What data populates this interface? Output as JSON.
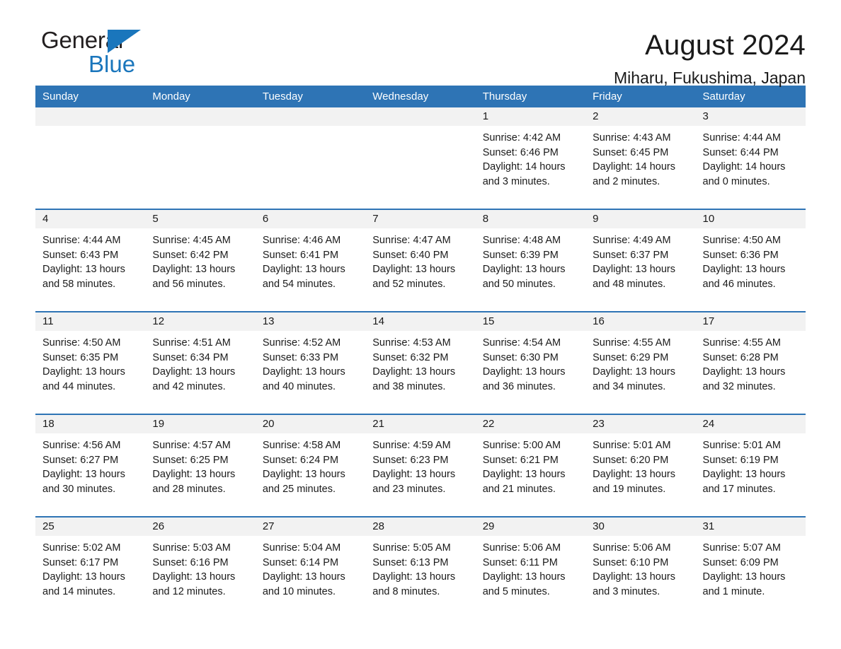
{
  "logo": {
    "word_one": "General",
    "word_two": "Blue",
    "triangle": "blue-triangle"
  },
  "header": {
    "title": "August 2024",
    "subtitle": "Miharu, Fukushima, Japan"
  },
  "colors": {
    "header_blue": "#2e74b5",
    "logo_blue": "#1a76bc",
    "daynum_band": "#f2f2f2",
    "text": "#1a1a1a",
    "page_background": "#ffffff"
  },
  "weekday_headers": [
    "Sunday",
    "Monday",
    "Tuesday",
    "Wednesday",
    "Thursday",
    "Friday",
    "Saturday"
  ],
  "weeks": [
    [
      {
        "day": "",
        "sunrise": "",
        "sunset": "",
        "daylight": ""
      },
      {
        "day": "",
        "sunrise": "",
        "sunset": "",
        "daylight": ""
      },
      {
        "day": "",
        "sunrise": "",
        "sunset": "",
        "daylight": ""
      },
      {
        "day": "",
        "sunrise": "",
        "sunset": "",
        "daylight": ""
      },
      {
        "day": "1",
        "sunrise": "Sunrise: 4:42 AM",
        "sunset": "Sunset: 6:46 PM",
        "daylight": "Daylight: 14 hours and 3 minutes."
      },
      {
        "day": "2",
        "sunrise": "Sunrise: 4:43 AM",
        "sunset": "Sunset: 6:45 PM",
        "daylight": "Daylight: 14 hours and 2 minutes."
      },
      {
        "day": "3",
        "sunrise": "Sunrise: 4:44 AM",
        "sunset": "Sunset: 6:44 PM",
        "daylight": "Daylight: 14 hours and 0 minutes."
      }
    ],
    [
      {
        "day": "4",
        "sunrise": "Sunrise: 4:44 AM",
        "sunset": "Sunset: 6:43 PM",
        "daylight": "Daylight: 13 hours and 58 minutes."
      },
      {
        "day": "5",
        "sunrise": "Sunrise: 4:45 AM",
        "sunset": "Sunset: 6:42 PM",
        "daylight": "Daylight: 13 hours and 56 minutes."
      },
      {
        "day": "6",
        "sunrise": "Sunrise: 4:46 AM",
        "sunset": "Sunset: 6:41 PM",
        "daylight": "Daylight: 13 hours and 54 minutes."
      },
      {
        "day": "7",
        "sunrise": "Sunrise: 4:47 AM",
        "sunset": "Sunset: 6:40 PM",
        "daylight": "Daylight: 13 hours and 52 minutes."
      },
      {
        "day": "8",
        "sunrise": "Sunrise: 4:48 AM",
        "sunset": "Sunset: 6:39 PM",
        "daylight": "Daylight: 13 hours and 50 minutes."
      },
      {
        "day": "9",
        "sunrise": "Sunrise: 4:49 AM",
        "sunset": "Sunset: 6:37 PM",
        "daylight": "Daylight: 13 hours and 48 minutes."
      },
      {
        "day": "10",
        "sunrise": "Sunrise: 4:50 AM",
        "sunset": "Sunset: 6:36 PM",
        "daylight": "Daylight: 13 hours and 46 minutes."
      }
    ],
    [
      {
        "day": "11",
        "sunrise": "Sunrise: 4:50 AM",
        "sunset": "Sunset: 6:35 PM",
        "daylight": "Daylight: 13 hours and 44 minutes."
      },
      {
        "day": "12",
        "sunrise": "Sunrise: 4:51 AM",
        "sunset": "Sunset: 6:34 PM",
        "daylight": "Daylight: 13 hours and 42 minutes."
      },
      {
        "day": "13",
        "sunrise": "Sunrise: 4:52 AM",
        "sunset": "Sunset: 6:33 PM",
        "daylight": "Daylight: 13 hours and 40 minutes."
      },
      {
        "day": "14",
        "sunrise": "Sunrise: 4:53 AM",
        "sunset": "Sunset: 6:32 PM",
        "daylight": "Daylight: 13 hours and 38 minutes."
      },
      {
        "day": "15",
        "sunrise": "Sunrise: 4:54 AM",
        "sunset": "Sunset: 6:30 PM",
        "daylight": "Daylight: 13 hours and 36 minutes."
      },
      {
        "day": "16",
        "sunrise": "Sunrise: 4:55 AM",
        "sunset": "Sunset: 6:29 PM",
        "daylight": "Daylight: 13 hours and 34 minutes."
      },
      {
        "day": "17",
        "sunrise": "Sunrise: 4:55 AM",
        "sunset": "Sunset: 6:28 PM",
        "daylight": "Daylight: 13 hours and 32 minutes."
      }
    ],
    [
      {
        "day": "18",
        "sunrise": "Sunrise: 4:56 AM",
        "sunset": "Sunset: 6:27 PM",
        "daylight": "Daylight: 13 hours and 30 minutes."
      },
      {
        "day": "19",
        "sunrise": "Sunrise: 4:57 AM",
        "sunset": "Sunset: 6:25 PM",
        "daylight": "Daylight: 13 hours and 28 minutes."
      },
      {
        "day": "20",
        "sunrise": "Sunrise: 4:58 AM",
        "sunset": "Sunset: 6:24 PM",
        "daylight": "Daylight: 13 hours and 25 minutes."
      },
      {
        "day": "21",
        "sunrise": "Sunrise: 4:59 AM",
        "sunset": "Sunset: 6:23 PM",
        "daylight": "Daylight: 13 hours and 23 minutes."
      },
      {
        "day": "22",
        "sunrise": "Sunrise: 5:00 AM",
        "sunset": "Sunset: 6:21 PM",
        "daylight": "Daylight: 13 hours and 21 minutes."
      },
      {
        "day": "23",
        "sunrise": "Sunrise: 5:01 AM",
        "sunset": "Sunset: 6:20 PM",
        "daylight": "Daylight: 13 hours and 19 minutes."
      },
      {
        "day": "24",
        "sunrise": "Sunrise: 5:01 AM",
        "sunset": "Sunset: 6:19 PM",
        "daylight": "Daylight: 13 hours and 17 minutes."
      }
    ],
    [
      {
        "day": "25",
        "sunrise": "Sunrise: 5:02 AM",
        "sunset": "Sunset: 6:17 PM",
        "daylight": "Daylight: 13 hours and 14 minutes."
      },
      {
        "day": "26",
        "sunrise": "Sunrise: 5:03 AM",
        "sunset": "Sunset: 6:16 PM",
        "daylight": "Daylight: 13 hours and 12 minutes."
      },
      {
        "day": "27",
        "sunrise": "Sunrise: 5:04 AM",
        "sunset": "Sunset: 6:14 PM",
        "daylight": "Daylight: 13 hours and 10 minutes."
      },
      {
        "day": "28",
        "sunrise": "Sunrise: 5:05 AM",
        "sunset": "Sunset: 6:13 PM",
        "daylight": "Daylight: 13 hours and 8 minutes."
      },
      {
        "day": "29",
        "sunrise": "Sunrise: 5:06 AM",
        "sunset": "Sunset: 6:11 PM",
        "daylight": "Daylight: 13 hours and 5 minutes."
      },
      {
        "day": "30",
        "sunrise": "Sunrise: 5:06 AM",
        "sunset": "Sunset: 6:10 PM",
        "daylight": "Daylight: 13 hours and 3 minutes."
      },
      {
        "day": "31",
        "sunrise": "Sunrise: 5:07 AM",
        "sunset": "Sunset: 6:09 PM",
        "daylight": "Daylight: 13 hours and 1 minute."
      }
    ]
  ]
}
